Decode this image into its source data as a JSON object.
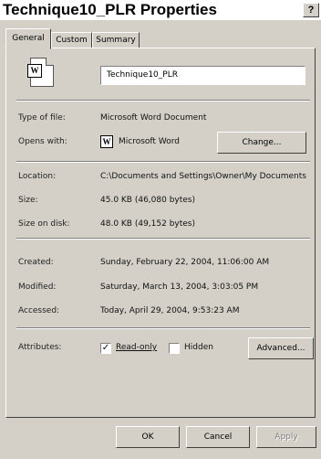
{
  "window": {
    "title": "Technique10_PLR Properties",
    "help_label": "?"
  },
  "tabs": [
    {
      "label": "General"
    },
    {
      "label": "Custom"
    },
    {
      "label": "Summary"
    }
  ],
  "general": {
    "icon": "word-document-icon",
    "file_name": "Technique10_PLR",
    "type_label": "Type of file:",
    "type_value": "Microsoft Word Document",
    "opens_label": "Opens with:",
    "opens_icon": "word-app-icon",
    "opens_value": "Microsoft Word",
    "change_label": "Change...",
    "location_label": "Location:",
    "location_value": "C:\\Documents and Settings\\Owner\\My Documents",
    "size_label": "Size:",
    "size_value": "45.0 KB (46,080 bytes)",
    "size_disk_label": "Size on disk:",
    "size_disk_value": "48.0 KB (49,152 bytes)",
    "created_label": "Created:",
    "created_value": "Sunday, February 22, 2004, 11:06:00 AM",
    "modified_label": "Modified:",
    "modified_value": "Saturday, March 13, 2004, 3:03:05 PM",
    "accessed_label": "Accessed:",
    "accessed_value": "Today, April 29, 2004, 9:53:23 AM",
    "attributes_label": "Attributes:",
    "readonly_label": "Read-only",
    "readonly_checked": true,
    "hidden_label": "Hidden",
    "hidden_checked": false,
    "advanced_label": "Advanced..."
  },
  "footer": {
    "ok_label": "OK",
    "cancel_label": "Cancel",
    "apply_label": "Apply"
  }
}
